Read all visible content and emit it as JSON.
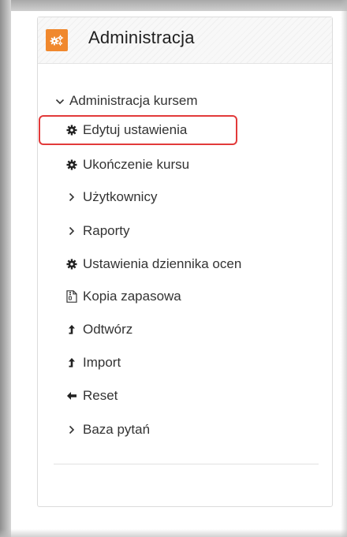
{
  "block": {
    "title": "Administracja",
    "header_icon": "gears-icon",
    "accent_color": "#f0882d",
    "highlight_color": "#e23a3a"
  },
  "menu": {
    "section_label": "Administracja kursem",
    "section_icon": "chevron-down-icon",
    "items": [
      {
        "label": "Edytuj ustawienia",
        "icon": "gear-icon",
        "highlighted": true
      },
      {
        "label": "Ukończenie kursu",
        "icon": "gear-icon"
      },
      {
        "label": "Użytkownicy",
        "icon": "chevron-right-icon"
      },
      {
        "label": "Raporty",
        "icon": "chevron-right-icon"
      },
      {
        "label": "Ustawienia dziennika ocen",
        "icon": "gear-icon"
      },
      {
        "label": "Kopia zapasowa",
        "icon": "file-archive-icon"
      },
      {
        "label": "Odtwórz",
        "icon": "level-up-icon"
      },
      {
        "label": "Import",
        "icon": "level-up-icon"
      },
      {
        "label": "Reset",
        "icon": "arrow-left-icon"
      },
      {
        "label": "Baza pytań",
        "icon": "chevron-right-icon"
      }
    ]
  }
}
